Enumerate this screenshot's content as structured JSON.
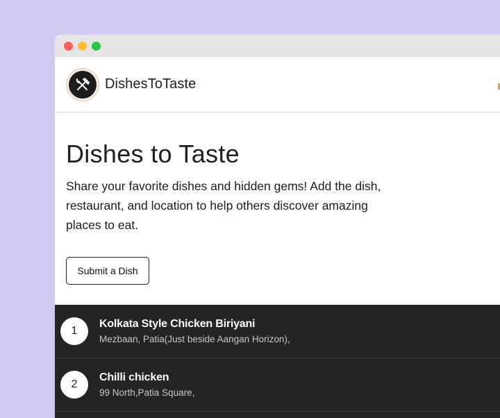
{
  "nav": {
    "brand": "DishesToTaste",
    "logo_icon": "fork-knife-icon"
  },
  "hero": {
    "title": "Dishes to Taste",
    "description": "Share your favorite dishes and hidden gems! Add the dish, restaurant, and location to help others discover amazing places to eat.",
    "submit_label": "Submit a Dish"
  },
  "dishes": [
    {
      "rank": "1",
      "name": "Kolkata Style Chicken Biriyani",
      "location": "Mezbaan, Patia(Just beside Aangan Horizon),"
    },
    {
      "rank": "2",
      "name": "Chilli chicken",
      "location": "99 North,Patia Square,"
    }
  ],
  "colors": {
    "background": "#cecaf4",
    "list_bg": "#242424",
    "accent": "#d4a53a"
  }
}
